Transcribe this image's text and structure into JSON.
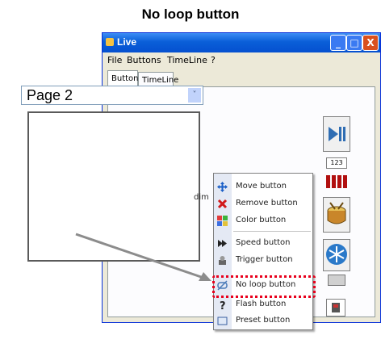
{
  "figure": {
    "title": "No loop button",
    "callout": [
      "No loop",
      "button"
    ]
  },
  "window": {
    "title": "Live",
    "controls": [
      "_",
      "□",
      "X"
    ]
  },
  "menubar": [
    "File",
    "Buttons",
    "TimeLine",
    "?"
  ],
  "tabs": [
    "Buttons",
    "TimeLine"
  ],
  "page_select": {
    "value": "Page 2",
    "arrow": "˅"
  },
  "canvas": {
    "partial_text": "dim"
  },
  "right_column": {
    "counter": "123",
    "play_icon": "play-pause-icon",
    "drum_icon": "drum-icon",
    "snow_icon": "snowflake-icon"
  },
  "context_menu": {
    "items": [
      {
        "label": "Move button",
        "icon": "move-arrows-icon"
      },
      {
        "label": "Remove button",
        "icon": "red-x-icon"
      },
      {
        "label": "Color button",
        "icon": "color-palette-icon"
      },
      {
        "label": "Speed button",
        "icon": "fast-forward-icon"
      },
      {
        "label": "Trigger button",
        "icon": "trigger-icon"
      },
      {
        "label": "No loop button",
        "icon": "no-loop-icon"
      },
      {
        "label": "Flash button",
        "icon": "question-icon"
      },
      {
        "label": "Preset button",
        "icon": "preset-icon"
      }
    ],
    "highlighted": "No loop button"
  },
  "colors": {
    "title_bar": "#0a5fd8",
    "highlight": "#e8001c",
    "callout_arrow": "#8c8c8c"
  }
}
